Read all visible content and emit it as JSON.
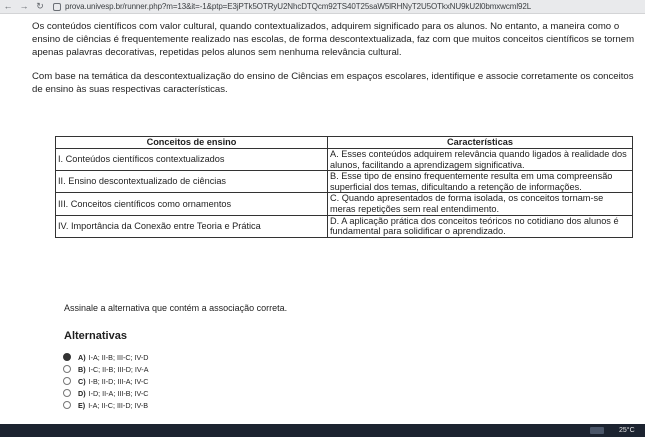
{
  "browser": {
    "back_icon": "arrow-left-icon",
    "forward_icon": "arrow-right-icon",
    "reload_icon": "reload-icon",
    "url": "prova.univesp.br/runner.php?m=13&it=-1&ptp=E3jPTk5OTRyU2NhcDTQcm92TS40T25saW5lRHNyT2U5OTkxNU9kU2l0bmxwcml92L"
  },
  "question": {
    "paragraph1": "Os conteúdos científicos com valor cultural, quando contextualizados, adquirem significado para os alunos. No entanto, a maneira como o ensino de ciências é frequentemente realizado nas escolas, de forma descontextualizada, faz com que muitos conceitos científicos se tornem apenas palavras decorativas, repetidas pelos alunos sem nenhuma relevância cultural.",
    "paragraph2": "Com base na temática da descontextualização do ensino de Ciências em espaços escolares, identifique e associe corretamente os conceitos de ensino às suas respectivas características."
  },
  "table": {
    "headers": [
      "Conceitos de ensino",
      "Características"
    ],
    "rows": [
      {
        "concept": "I. Conteúdos científicos contextualizados",
        "characteristic": "A. Esses conteúdos adquirem relevância quando ligados à realidade dos alunos, facilitando a aprendizagem significativa."
      },
      {
        "concept": "II. Ensino descontextualizado de ciências",
        "characteristic": "B. Esse tipo de ensino frequentemente resulta em uma compreensão superficial dos temas, dificultando a retenção de informações."
      },
      {
        "concept": "III. Conceitos científicos como ornamentos",
        "characteristic": "C. Quando apresentados de forma isolada, os conceitos tornam-se meras repetições sem real entendimento."
      },
      {
        "concept": "IV. Importância da Conexão entre Teoria e Prática",
        "characteristic": "D. A aplicação prática dos conceitos teóricos no cotidiano dos alunos é fundamental para solidificar o aprendizado."
      }
    ]
  },
  "instruction": "Assinale a alternativa que contém a associação correta.",
  "alternatives": {
    "title": "Alternativas",
    "selected": "A",
    "options": [
      {
        "letter": "A)",
        "text": "I-A; II-B; III-C; IV-D"
      },
      {
        "letter": "B)",
        "text": "I-C; II-B; III-D; IV-A"
      },
      {
        "letter": "C)",
        "text": "I-B; II-D; III-A; IV-C"
      },
      {
        "letter": "D)",
        "text": "I-D; II-A; III-B; IV-C"
      },
      {
        "letter": "E)",
        "text": "I-A; II-C; III-D; IV-B"
      }
    ]
  },
  "taskbar": {
    "temperature": "25°C",
    "weather_icon": "weather-icon"
  }
}
